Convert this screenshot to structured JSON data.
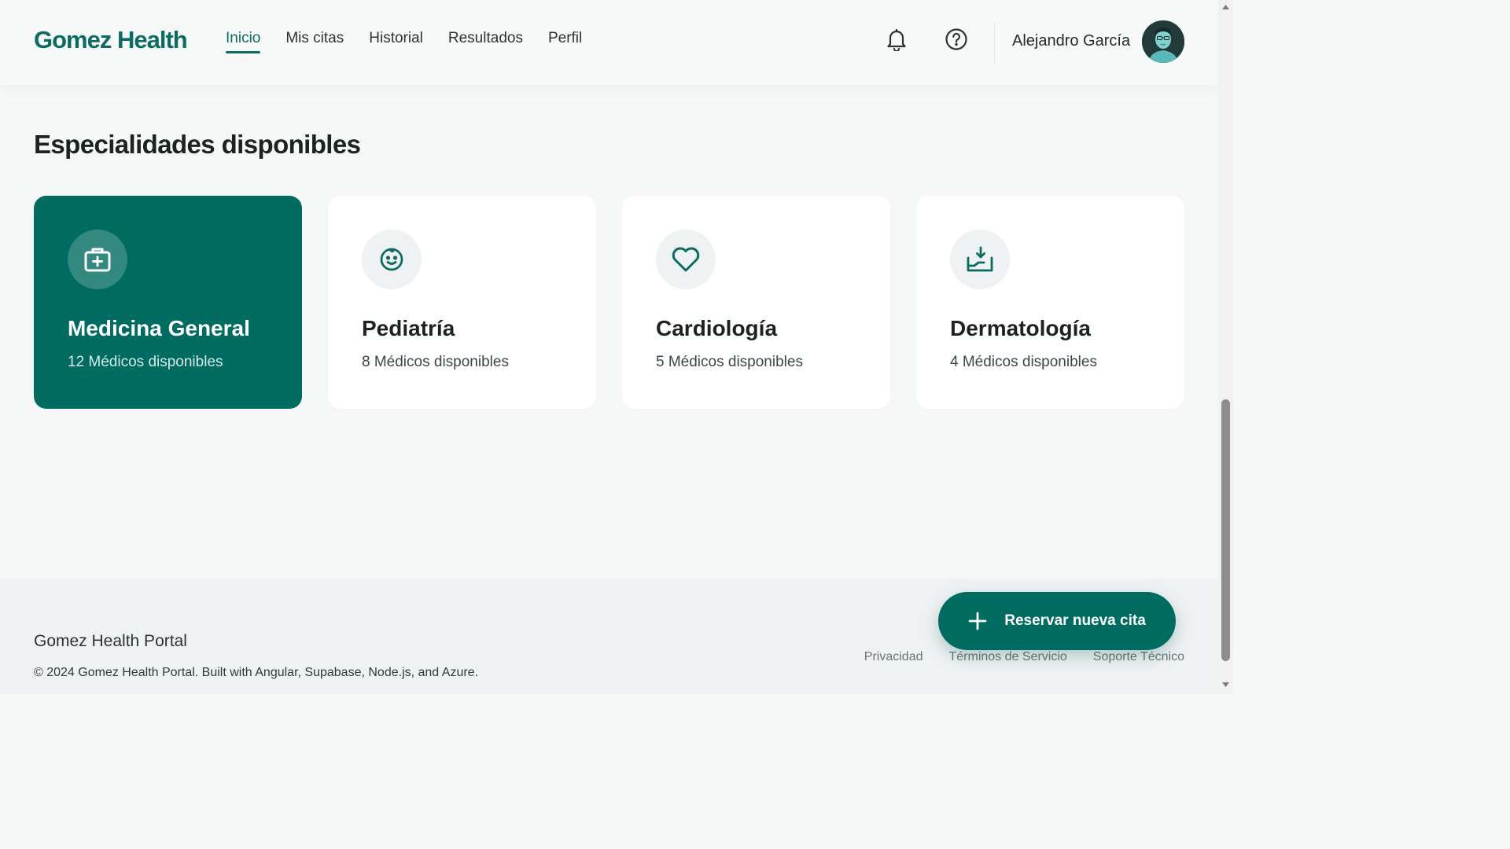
{
  "header": {
    "brand": "Gomez Health",
    "nav": [
      {
        "label": "Inicio",
        "active": true
      },
      {
        "label": "Mis citas",
        "active": false
      },
      {
        "label": "Historial",
        "active": false
      },
      {
        "label": "Resultados",
        "active": false
      },
      {
        "label": "Perfil",
        "active": false
      }
    ],
    "icons": [
      "bell-icon",
      "help-icon"
    ],
    "user_name": "Alejandro García"
  },
  "specialties": {
    "title": "Especialidades disponibles",
    "cards": [
      {
        "name": "Medicina General",
        "doctors": "12 Médicos disponibles",
        "icon": "medical-kit-icon",
        "selected": true
      },
      {
        "name": "Pediatría",
        "doctors": "8 Médicos disponibles",
        "icon": "baby-face-icon",
        "selected": false
      },
      {
        "name": "Cardiología",
        "doctors": "5 Médicos disponibles",
        "icon": "heart-icon",
        "selected": false
      },
      {
        "name": "Dermatología",
        "doctors": "4 Médicos disponibles",
        "icon": "hand-care-icon",
        "selected": false
      }
    ]
  },
  "fab": {
    "label": "Reservar nueva cita",
    "icon": "plus-icon"
  },
  "footer": {
    "title": "Gomez Health Portal",
    "copyright": "© 2024 Gomez Health Portal. Built with Angular, Supabase, Node.js, and Azure.",
    "links": [
      "Privacidad",
      "Términos de Servicio",
      "Soporte Técnico"
    ]
  },
  "colors": {
    "accent": "#006b60",
    "brand": "#0d6b61",
    "background": "#f6f8f8"
  }
}
